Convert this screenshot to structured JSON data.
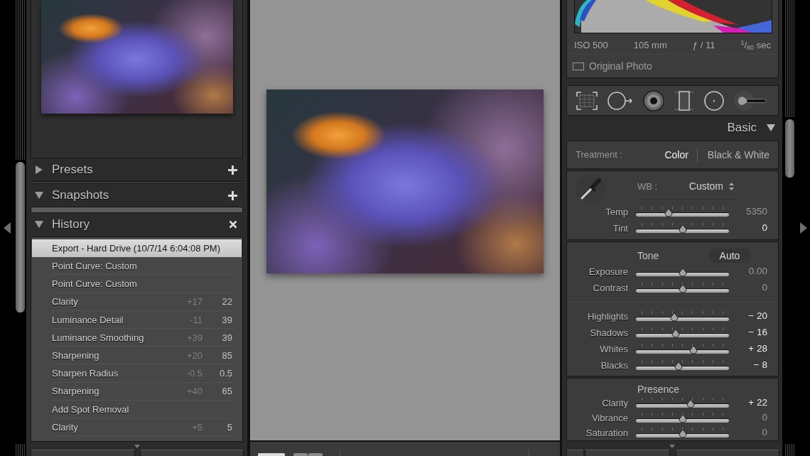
{
  "left_panel": {
    "sections": [
      {
        "title": "Presets",
        "expanded": false,
        "kind": "add"
      },
      {
        "title": "Snapshots",
        "expanded": true,
        "kind": "add"
      },
      {
        "title": "History",
        "expanded": true,
        "kind": "clear",
        "items": [
          {
            "label": "Export - Hard Drive (10/7/14 6:04:08 PM)",
            "selected": true
          },
          {
            "label": "Point Curve: Custom",
            "selected": false
          },
          {
            "label": "Point Curve: Custom",
            "selected": false
          },
          {
            "label": "Clarity",
            "change": "+17",
            "value": "22",
            "selected": false
          },
          {
            "label": "Luminance Detail",
            "change": "-11",
            "value": "39",
            "selected": false
          },
          {
            "label": "Luminance Smoothing",
            "change": "+39",
            "value": "39",
            "selected": false
          },
          {
            "label": "Sharpening",
            "change": "+20",
            "value": "85",
            "selected": false
          },
          {
            "label": "Sharpen Radius",
            "change": "-0.5",
            "value": "0.5",
            "selected": false
          },
          {
            "label": "Sharpening",
            "change": "+40",
            "value": "65",
            "selected": false
          },
          {
            "label": "Add Spot Removal",
            "selected": false
          },
          {
            "label": "Clarity",
            "change": "+5",
            "value": "5",
            "selected": false
          }
        ]
      }
    ]
  },
  "right_panel": {
    "exif": [
      "ISO 500",
      "105 mm",
      "ƒ / 11",
      "$^{1}$/$_{80}$ sec"
    ],
    "original_photo": {
      "label": "Original Photo",
      "checked": false
    },
    "tools": [
      {
        "kind": "crop"
      },
      {
        "kind": "spot_removal"
      },
      {
        "kind": "red_eye"
      },
      {
        "kind": "graduated_filter"
      },
      {
        "kind": "radial_filter"
      },
      {
        "kind": "brush"
      }
    ],
    "basic": {
      "title": "Basic",
      "expanded": true,
      "treatment": {
        "label": "Treatment :",
        "options": [
          {
            "label": "Color",
            "selected": true
          },
          {
            "label": "Black & White",
            "selected": false
          }
        ]
      },
      "panels": [
        {
          "kind": "white_balance",
          "label": "WB :",
          "value": "Custom",
          "groups": [
            [
              {
                "label": "Temp",
                "level": 0.35,
                "reading": "5350",
                "dimmed": true,
                "ticks": true
              },
              {
                "label": "Tint",
                "level": 0.5,
                "reading": "0",
                "dimmed": false,
                "ticks": true
              }
            ]
          ]
        },
        {
          "kind": "section",
          "title": "Tone",
          "button": "Auto",
          "groups": [
            [
              {
                "label": "Exposure",
                "level": 0.5,
                "reading": "0.00",
                "dimmed": true,
                "ticks": false
              },
              {
                "label": "Contrast",
                "level": 0.5,
                "reading": "0",
                "dimmed": true,
                "ticks": true
              }
            ],
            [
              {
                "label": "Highlights",
                "level": 0.41,
                "reading": "− 20",
                "dimmed": false,
                "ticks": true
              },
              {
                "label": "Shadows",
                "level": 0.43,
                "reading": "− 16",
                "dimmed": false,
                "ticks": true
              },
              {
                "label": "Whites",
                "level": 0.62,
                "reading": "+ 28",
                "dimmed": false,
                "ticks": true
              },
              {
                "label": "Blacks",
                "level": 0.46,
                "reading": "− 8",
                "dimmed": false,
                "ticks": true
              }
            ]
          ]
        },
        {
          "kind": "section",
          "title": "Presence",
          "groups": [
            [
              {
                "label": "Clarity",
                "level": 0.59,
                "reading": "+ 22",
                "dimmed": false,
                "ticks": true
              },
              {
                "label": "Vibrance",
                "level": 0.5,
                "reading": "0",
                "dimmed": true,
                "ticks": true
              },
              {
                "label": "Saturation",
                "level": 0.5,
                "reading": "0",
                "dimmed": true,
                "ticks": true
              }
            ]
          ]
        }
      ]
    }
  }
}
